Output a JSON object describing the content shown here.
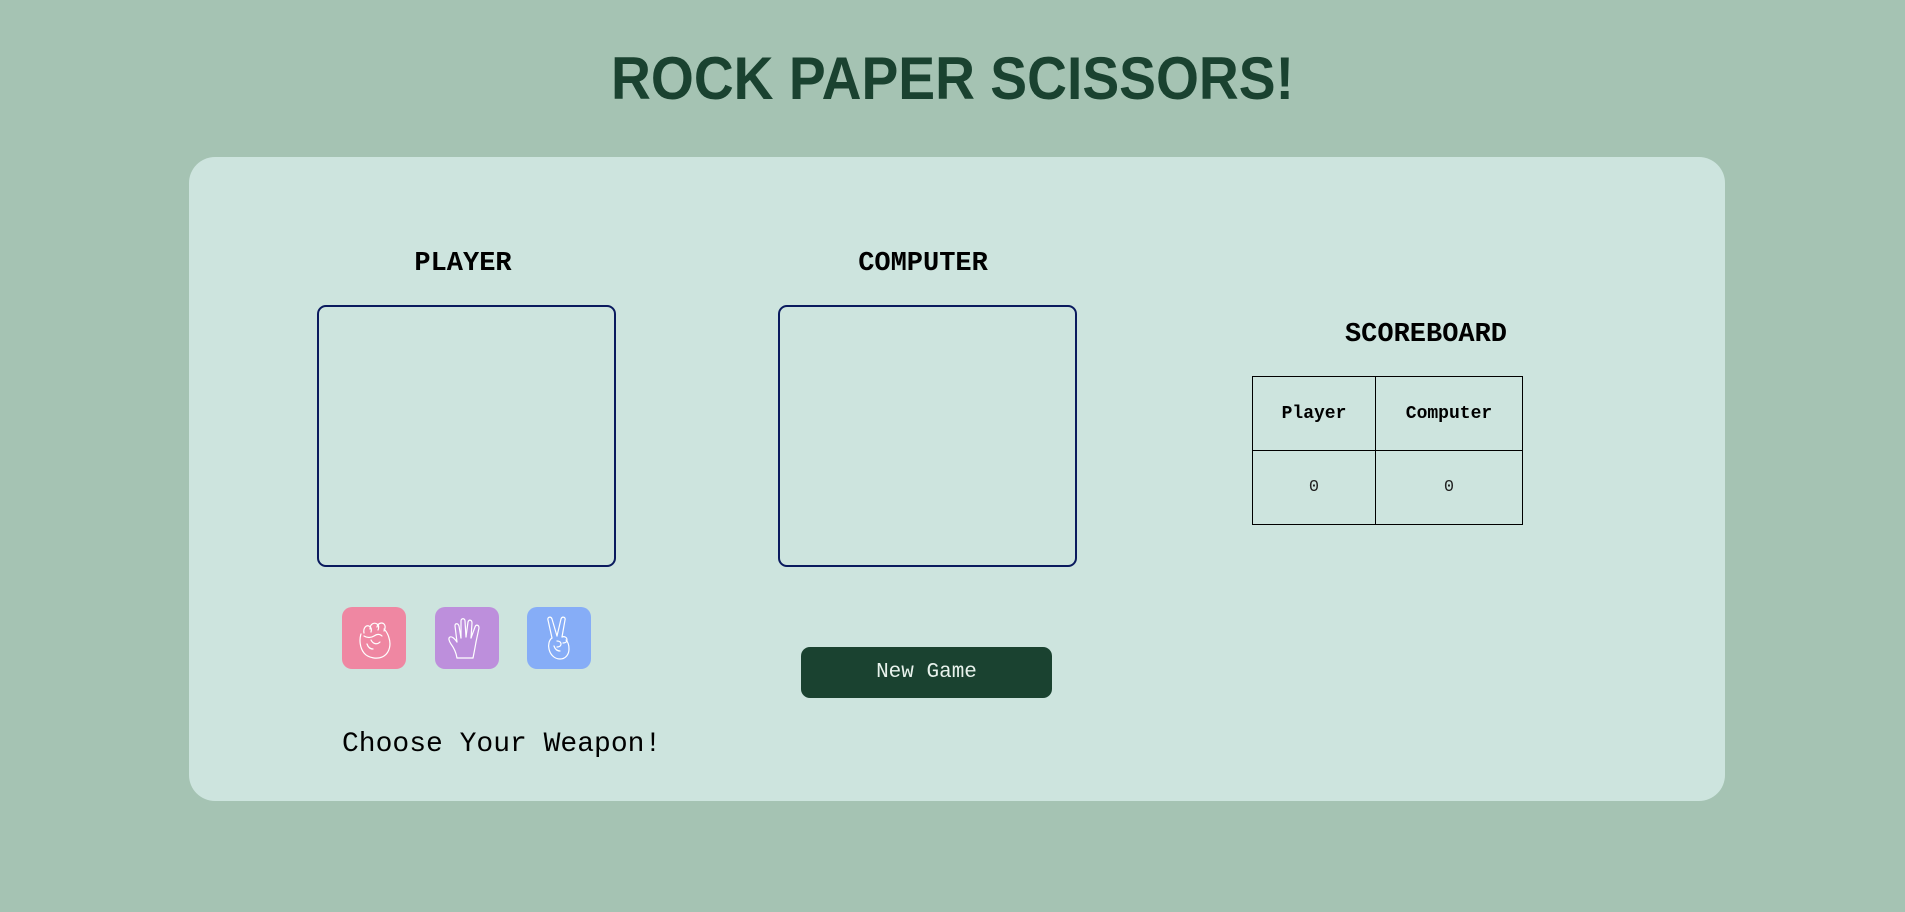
{
  "title": "ROCK PAPER SCISSORS!",
  "player": {
    "heading": "PLAYER"
  },
  "computer": {
    "heading": "COMPUTER"
  },
  "weapons": [
    {
      "name": "rock",
      "icon": "fist-icon",
      "color": "#ef87a2"
    },
    {
      "name": "paper",
      "icon": "open-hand-icon",
      "color": "#bd8fdc"
    },
    {
      "name": "scissors",
      "icon": "peace-hand-icon",
      "color": "#86adf7"
    }
  ],
  "new_game_label": "New Game",
  "message": "Choose Your Weapon!",
  "scoreboard": {
    "heading": "SCOREBOARD",
    "columns": [
      "Player",
      "Computer"
    ],
    "scores": [
      "0",
      "0"
    ]
  },
  "colors": {
    "background": "#a5c3b3",
    "card": "#cde4de",
    "title": "#1a4230",
    "button": "#1a4230",
    "display_border": "#0a1a5e"
  }
}
